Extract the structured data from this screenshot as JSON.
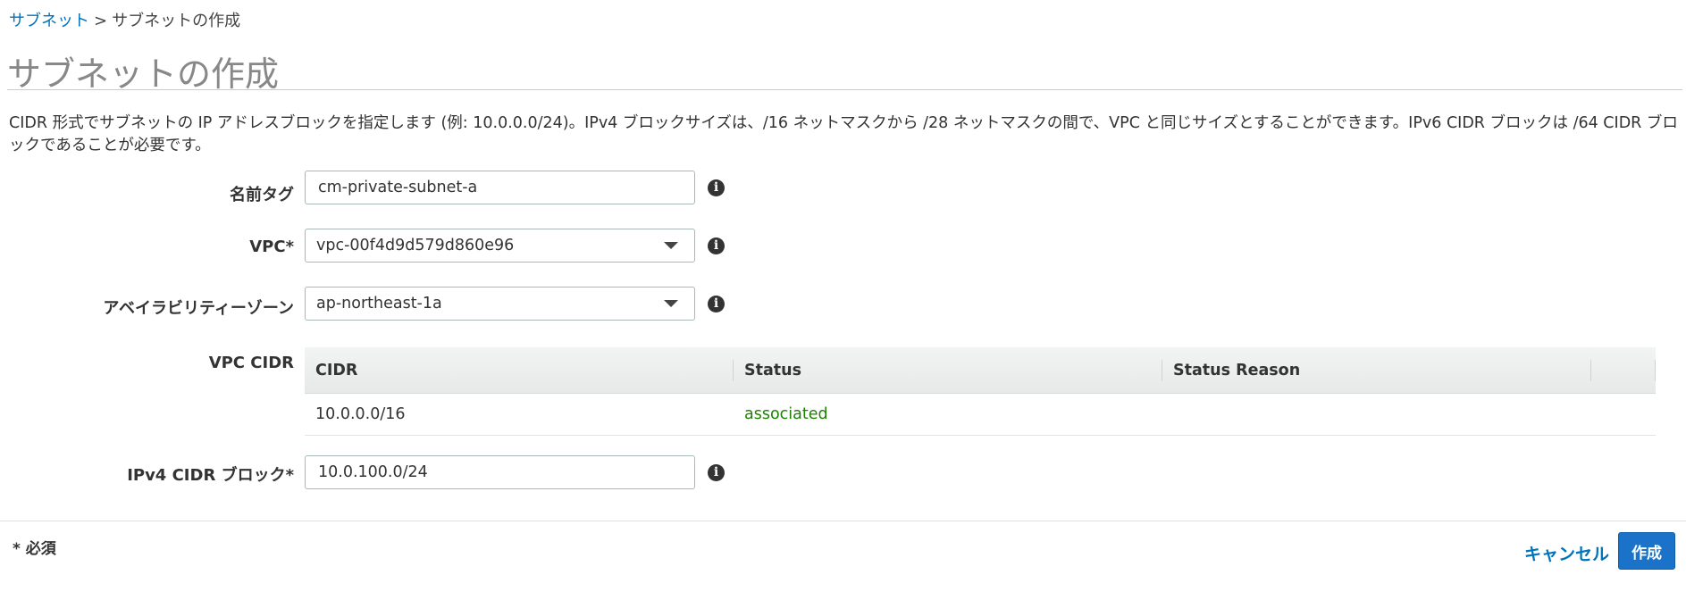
{
  "breadcrumb": {
    "link": "サブネット",
    "separator": ">",
    "current": "サブネットの作成"
  },
  "page": {
    "title": "サブネットの作成",
    "description": "CIDR 形式でサブネットの IP アドレスブロックを指定します (例: 10.0.0.0/24)。IPv4 ブロックサイズは、/16 ネットマスクから /28 ネットマスクの間で、VPC と同じサイズとすることができます。IPv6 CIDR ブロックは /64 CIDR ブロックであることが必要です。"
  },
  "form": {
    "name_tag": {
      "label": "名前タグ",
      "value": "cm-private-subnet-a"
    },
    "vpc": {
      "label": "VPC*",
      "value": "vpc-00f4d9d579d860e96"
    },
    "availability_zone": {
      "label": "アベイラビリティーゾーン",
      "value": "ap-northeast-1a"
    },
    "vpc_cidr": {
      "label": "VPC CIDR",
      "columns": [
        "CIDR",
        "Status",
        "Status Reason"
      ],
      "rows": [
        {
          "cidr": "10.0.0.0/16",
          "status": "associated",
          "status_reason": ""
        }
      ]
    },
    "ipv4_cidr": {
      "label": "IPv4 CIDR ブロック*",
      "value": "10.0.100.0/24"
    }
  },
  "footer": {
    "required_note": "* 必須",
    "cancel_label": "キャンセル",
    "create_label": "作成"
  },
  "icons": {
    "info": "info-icon",
    "dropdown": "chevron-down-icon"
  },
  "colors": {
    "link": "#0073bb",
    "primary_button": "#1a73c9",
    "status_ok": "#1d8102"
  }
}
